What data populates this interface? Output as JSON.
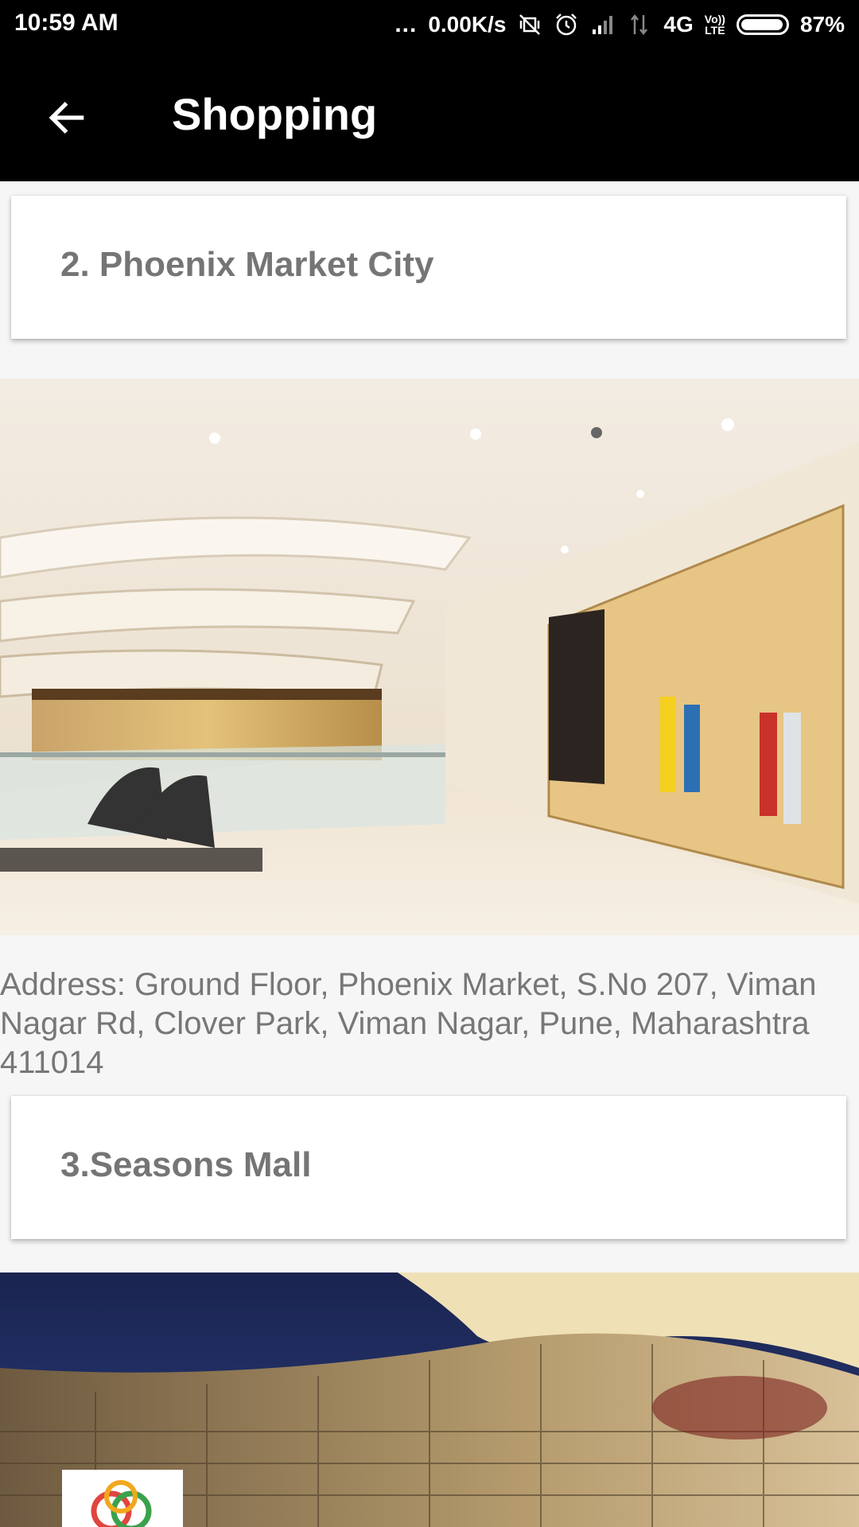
{
  "status_bar": {
    "time": "10:59 AM",
    "dots": "...",
    "speed": "0.00K/s",
    "network": "4G",
    "lte_top": "Vo))",
    "lte_bottom": "LTE",
    "battery": "87%"
  },
  "app_bar": {
    "title": "Shopping",
    "back_icon": "arrow-left-icon"
  },
  "list": [
    {
      "title": "2. Phoenix Market City",
      "image": "mall-interior-photo",
      "address": "Address: Ground Floor, Phoenix Market, S.No 207, Viman Nagar Rd, Clover Park, Viman Nagar, Pune, Maharashtra 411014"
    },
    {
      "title": "3.Seasons Mall",
      "image": "mall-exterior-photo"
    }
  ],
  "colors": {
    "app_bar": "#000000",
    "background": "#f6f6f6",
    "card": "#ffffff",
    "card_title": "#757575",
    "address_text": "#777777"
  }
}
